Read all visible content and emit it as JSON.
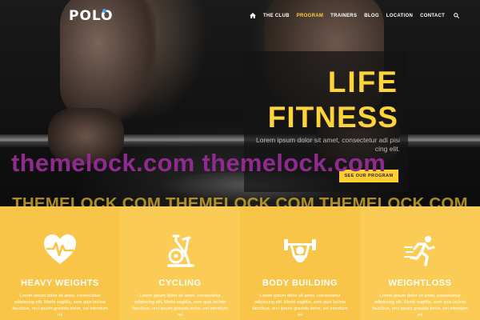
{
  "header": {
    "logo": "POLO",
    "nav": [
      "THE CLUB",
      "PROGRAM",
      "TRAINERS",
      "BLOG",
      "LOCATION",
      "CONTACT"
    ],
    "active_nav": "PROGRAM",
    "accent_color": "#ffd439"
  },
  "hero": {
    "title_line1": "LIFE",
    "title_line2": "FITNESS",
    "text": "Lorem ipsum dolor sit amet, consectetur adi pisi cing elit.",
    "button": "SEE OUR PROGRAM"
  },
  "watermark": {
    "line1": "themelock.com themelock.com",
    "line2": "THEMELOCK.COM THEMELOCK.COM THEMELOCK.COM"
  },
  "features": [
    {
      "title": "HEAVY WEIGHTS",
      "icon": "heart-pulse-icon",
      "text": "Lorem ipsum dolor sit amet, consectetur adipiscing elit. Morbi sagittis, sem quis lacinia faucibus, orci ipsum gravida tortor, vel interdum mi"
    },
    {
      "title": "CYCLING",
      "icon": "exercise-bike-icon",
      "text": "Lorem ipsum dolor sit amet, consectetur adipiscing elit. Morbi sagittis, sem quis lacinia faucibus, orci ipsum gravida tortor, vel interdum mi"
    },
    {
      "title": "BODY BUILDING",
      "icon": "weightlifter-icon",
      "text": "Lorem ipsum dolor sit amet, consectetur adipiscing elit. Morbi sagittis, sem quis lacinia faucibus, orci ipsum gravida tortor, vel interdum mi"
    },
    {
      "title": "WEIGHTLOSS",
      "icon": "running-man-icon",
      "text": "Lorem ipsum dolor sit amet, consectetur adipiscing elit. Morbi sagittis, sem quis lacinia faucibus, orci ipsum gravida tortor, vel interdum mi"
    }
  ]
}
